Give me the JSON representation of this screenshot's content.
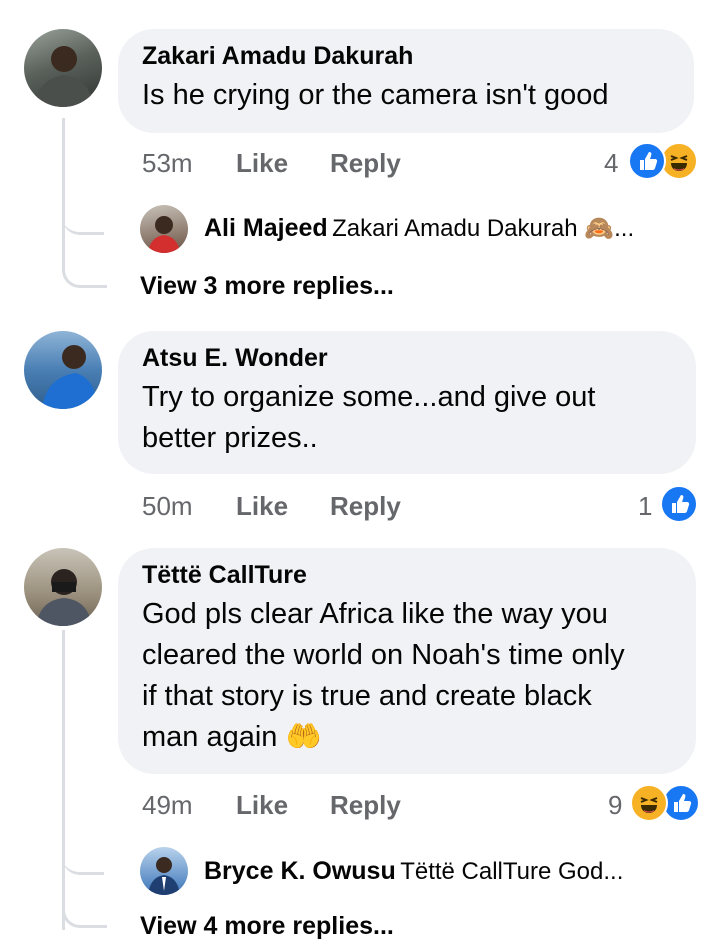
{
  "comments": [
    {
      "name": "Zakari Amadu Dakurah",
      "text": "Is he crying or the camera isn't good",
      "time": "53m",
      "like_label": "Like",
      "reply_label": "Reply",
      "reaction_count": "4",
      "reactions": [
        "like-icon",
        "haha-icon"
      ],
      "replies_preview": {
        "name": "Ali Majeed",
        "text": "Zakari Amadu Dakurah 🙈...",
        "more": "View 3 more replies..."
      }
    },
    {
      "name": "Atsu E. Wonder",
      "text": "Try to organize some...and give out\nbetter prizes..",
      "time": "50m",
      "like_label": "Like",
      "reply_label": "Reply",
      "reaction_count": "1",
      "reactions": [
        "like-icon"
      ]
    },
    {
      "name": "Tëttë CallTure",
      "text": "God pls clear Africa like the way you\ncleared the world on Noah's time only\nif that story is true and create black\nman again 🤲",
      "time": "49m",
      "like_label": "Like",
      "reply_label": "Reply",
      "reaction_count": "9",
      "reactions": [
        "haha-icon",
        "like-icon"
      ],
      "replies_preview": {
        "name": "Bryce K. Owusu",
        "text": "Tëttë CallTure God...",
        "more": "View 4 more replies..."
      }
    }
  ],
  "colors": {
    "bubble": "#f0f2f5",
    "meta": "#65676b",
    "like_blue": "#1877f2",
    "haha_yellow": "#f7b125"
  }
}
